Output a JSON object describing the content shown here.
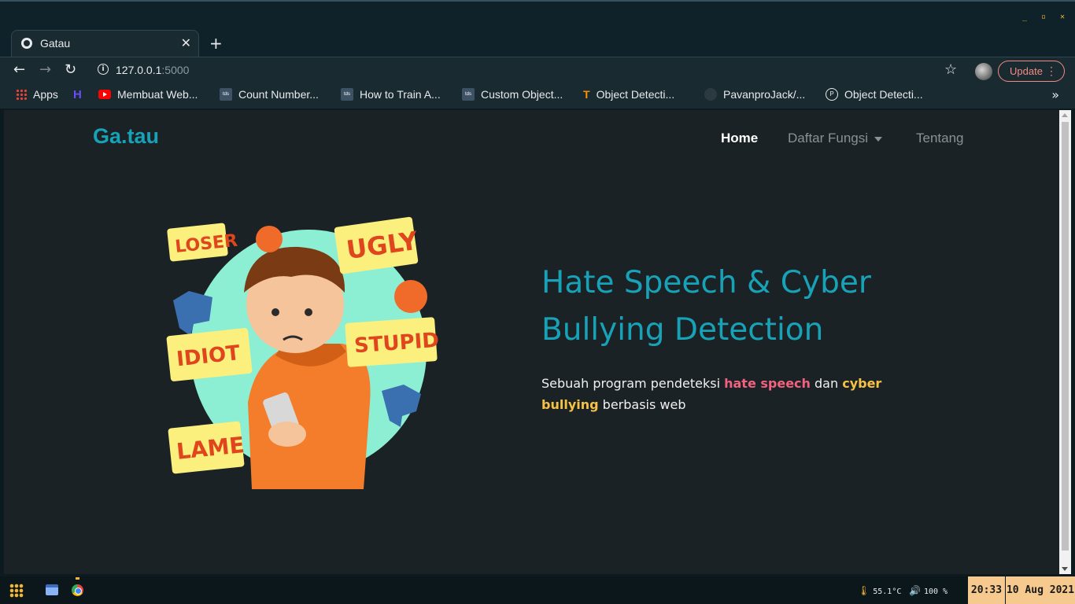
{
  "browser": {
    "tab_title": "Gatau",
    "url_host": "127.0.0.1",
    "url_port": ":5000",
    "update_label": "Update",
    "bookmarks": [
      {
        "label": "Apps",
        "icon": "apps-grid-icon"
      },
      {
        "label": "",
        "icon": "h-logo-icon"
      },
      {
        "label": "Membuat Web...",
        "icon": "youtube-icon"
      },
      {
        "label": "Count Number...",
        "icon": "tds-icon"
      },
      {
        "label": "How to Train A...",
        "icon": "tds-icon"
      },
      {
        "label": "Custom Object...",
        "icon": "tds-icon"
      },
      {
        "label": "Object Detecti...",
        "icon": "tensorflow-icon"
      },
      {
        "label": "PavanproJack/...",
        "icon": "github-icon"
      },
      {
        "label": "Object Detecti...",
        "icon": "pyimagesearch-icon"
      }
    ]
  },
  "navbar": {
    "brand": "Ga.tau",
    "links": [
      "Home",
      "Daftar Fungsi",
      "Tentang"
    ]
  },
  "hero": {
    "title": "Hate Speech & Cyber Bullying Detection",
    "desc_before": "Sebuah program pendeteksi ",
    "desc_hl1": "hate speech",
    "desc_mid": " dan ",
    "desc_hl2": "cyber bullying",
    "desc_after": " berbasis web",
    "illustration_words": [
      "LOSER",
      "UGLY",
      "IDIOT",
      "STUPID",
      "LAME"
    ]
  },
  "taskbar": {
    "temperature": "55.1°C",
    "volume": "100 %",
    "time": "20:33",
    "date": "10 Aug 2021"
  },
  "colors": {
    "accent": "#17a2b8",
    "page_bg": "#1b2226",
    "highlight_pink": "#f2627f",
    "highlight_yellow": "#f6c244"
  }
}
